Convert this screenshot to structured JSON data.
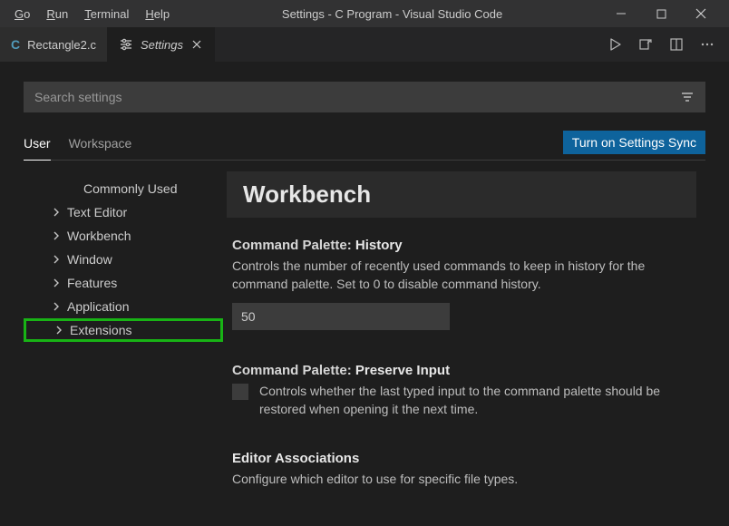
{
  "menu": {
    "go": "Go",
    "run": "Run",
    "terminal": "Terminal",
    "help": "Help"
  },
  "window_title": "Settings - C Program - Visual Studio Code",
  "tabs": [
    {
      "label": "Rectangle2.c"
    },
    {
      "label": "Settings"
    }
  ],
  "search": {
    "placeholder": "Search settings"
  },
  "scopes": {
    "user": "User",
    "workspace": "Workspace"
  },
  "sync_button": "Turn on Settings Sync",
  "tree": {
    "commonly_used": "Commonly Used",
    "text_editor": "Text Editor",
    "workbench": "Workbench",
    "window": "Window",
    "features": "Features",
    "application": "Application",
    "extensions": "Extensions"
  },
  "section_title": "Workbench",
  "settings": {
    "history": {
      "cat": "Command Palette: ",
      "name": "History",
      "desc": "Controls the number of recently used commands to keep in history for the command palette. Set to 0 to disable command history.",
      "value": "50"
    },
    "preserve": {
      "cat": "Command Palette: ",
      "name": "Preserve Input",
      "desc": "Controls whether the last typed input to the command palette should be restored when opening it the next time."
    },
    "assoc": {
      "name": "Editor Associations",
      "desc": "Configure which editor to use for specific file types."
    }
  }
}
